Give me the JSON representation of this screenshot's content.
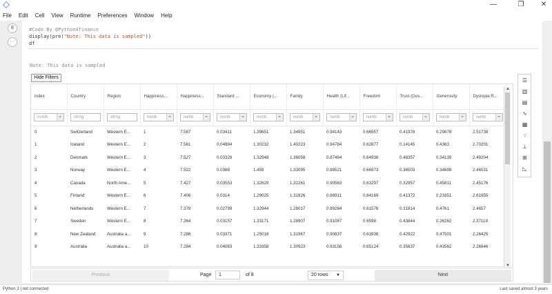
{
  "window": {
    "minimize": "—",
    "maximize": "❐",
    "close": "✕"
  },
  "menu": [
    "File",
    "Edit",
    "Cell",
    "View",
    "Runtime",
    "Preferences",
    "Window",
    "Help"
  ],
  "gutter": {
    "exec_count": "8",
    "more": "···"
  },
  "code": {
    "line1": "#Code By @Python4finance",
    "line2a": "display(pre(",
    "line2s": "\"Note: This data is sampled\"",
    "line2b": "))",
    "line3": "df"
  },
  "output": {
    "note": "Note: This data is sampled",
    "hide_filters": "Hide Filters"
  },
  "table": {
    "columns": [
      "index",
      "Country",
      "Region",
      "Happiness...",
      "Happiness...",
      "Standard ...",
      "Economy (...",
      "Family",
      "Health (Lif...",
      "Freedom",
      "Trust (Gov...",
      "Generosity",
      "Dystopia R..."
    ],
    "filters": [
      "numb",
      "string",
      "string",
      "numb",
      "numb",
      "numb",
      "numb",
      "numb",
      "numb",
      "numb",
      "numb",
      "numb",
      "numb"
    ],
    "rows": [
      [
        "0",
        "Switzerland",
        "Western E...",
        "1",
        "7.587",
        "0.03411",
        "1.39651",
        "1.34951",
        "0.94143",
        "0.66557",
        "0.41978",
        "0.29678",
        "2.51738"
      ],
      [
        "1",
        "Iceland",
        "Western E...",
        "2",
        "7.561",
        "0.04884",
        "1.30232",
        "1.40223",
        "0.94784",
        "0.62877",
        "0.14145",
        "0.4363",
        "2.70201"
      ],
      [
        "2",
        "Denmark",
        "Western E...",
        "3",
        "7.527",
        "0.03328",
        "1.32548",
        "1.36058",
        "0.87464",
        "0.64938",
        "0.48357",
        "0.34139",
        "2.49204"
      ],
      [
        "3",
        "Norway",
        "Western E...",
        "4",
        "7.522",
        "0.0388",
        "1.459",
        "1.33095",
        "0.88521",
        "0.66973",
        "0.36503",
        "0.34699",
        "2.46531"
      ],
      [
        "4",
        "Canada",
        "North Ame...",
        "5",
        "7.427",
        "0.03553",
        "1.32629",
        "1.32261",
        "0.90563",
        "0.63297",
        "0.32957",
        "0.45811",
        "2.45176"
      ],
      [
        "5",
        "Finland",
        "Western E...",
        "6",
        "7.406",
        "0.0314",
        "1.29025",
        "1.31826",
        "0.88911",
        "0.64169",
        "0.41372",
        "0.23351",
        "2.61955"
      ],
      [
        "6",
        "Netherlands",
        "Western E...",
        "7",
        "7.378",
        "0.02799",
        "1.32944",
        "1.28017",
        "0.89284",
        "0.61576",
        "0.31814",
        "0.4761",
        "2.4657"
      ],
      [
        "7",
        "Sweden",
        "Western E...",
        "8",
        "7.364",
        "0.03157",
        "1.33171",
        "1.28907",
        "0.91087",
        "0.6598",
        "0.43844",
        "0.36262",
        "2.37119"
      ],
      [
        "8",
        "New Zealand",
        "Australia a...",
        "9",
        "7.286",
        "0.03371",
        "1.25018",
        "1.31967",
        "0.90837",
        "0.63938",
        "0.42922",
        "0.47501",
        "2.26425"
      ],
      [
        "9",
        "Australia",
        "Australia a...",
        "10",
        "7.284",
        "0.04083",
        "1.33358",
        "1.30923",
        "0.93156",
        "0.65124",
        "0.35637",
        "0.43562",
        "2.26646"
      ]
    ]
  },
  "pager": {
    "previous": "Previous",
    "page_label": "Page",
    "page_value": "1",
    "of": "of 8",
    "rows": "20 rows",
    "next": "Next"
  },
  "status": {
    "kernel": "Python 3 | not connected",
    "saved": "Last saved almost 3 years"
  }
}
